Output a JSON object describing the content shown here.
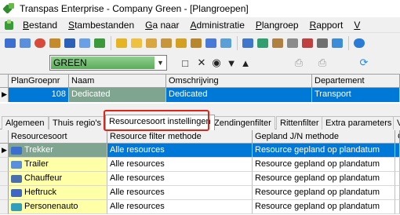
{
  "window": {
    "title": "Transpas Enterprise - Company Green - [Plangroepen]"
  },
  "menu": {
    "items": [
      {
        "label": "Bestand",
        "u": "B",
        "rest": "estand"
      },
      {
        "label": "Stambestanden",
        "u": "S",
        "rest": "tambestanden"
      },
      {
        "label": "Ga naar",
        "u": "G",
        "rest": "a naar"
      },
      {
        "label": "Administratie",
        "u": "A",
        "rest": "dministratie"
      },
      {
        "label": "Plangroep",
        "u": "P",
        "rest": "langroep"
      },
      {
        "label": "Rapport",
        "u": "R",
        "rest": "apport"
      },
      {
        "label": "V",
        "u": "V",
        "rest": ""
      }
    ]
  },
  "toolbar": {
    "combo_value": "GREEN",
    "icons": [
      "document-icon",
      "delete-icon",
      "eye-icon",
      "filter-icon",
      "filter-clear-icon",
      "print-icon",
      "print-preview-icon",
      "refresh-icon"
    ]
  },
  "plangroep_grid": {
    "headers": [
      "PlanGroepnr",
      "Naam",
      "Omschrijving",
      "Departement"
    ],
    "row": {
      "nr": "108",
      "naam": "Dedicated",
      "omschrijving": "Dedicated",
      "departement": "Transport"
    }
  },
  "tabs": [
    "Algemeen",
    "Thuis regio's",
    "Resourcesoort instellingen",
    "Zendingenfilter",
    "Rittenfilter",
    "Extra parameters",
    "V"
  ],
  "active_tab": "Resourcesoort instellingen",
  "resource_grid": {
    "headers": [
      "Resourcesoort",
      "Resource filter methode",
      "Gepland J/N methode",
      "Ge"
    ],
    "rows": [
      {
        "soort": "Trekker",
        "icon": "truck-icon",
        "filter": "Alle resources",
        "gepland": "Resource gepland op plandatum"
      },
      {
        "soort": "Trailer",
        "icon": "trailer-icon",
        "filter": "Alle resources",
        "gepland": "Resource gepland op plandatum"
      },
      {
        "soort": "Chauffeur",
        "icon": "driver-icon",
        "filter": "Alle resources",
        "gepland": "Resource gepland op plandatum"
      },
      {
        "soort": "Heftruck",
        "icon": "forklift-icon",
        "filter": "Alle resources",
        "gepland": "Resource gepland op plandatum"
      },
      {
        "soort": "Personenauto",
        "icon": "car-icon",
        "filter": "Alle resources",
        "gepland": "Resource gepland op plandatum"
      }
    ]
  },
  "colors": {
    "selection": "#0078d7",
    "selection_alt": "#7fa48f",
    "highlight_box": "#e2231a",
    "yellow_cell": "#ffffa8"
  }
}
